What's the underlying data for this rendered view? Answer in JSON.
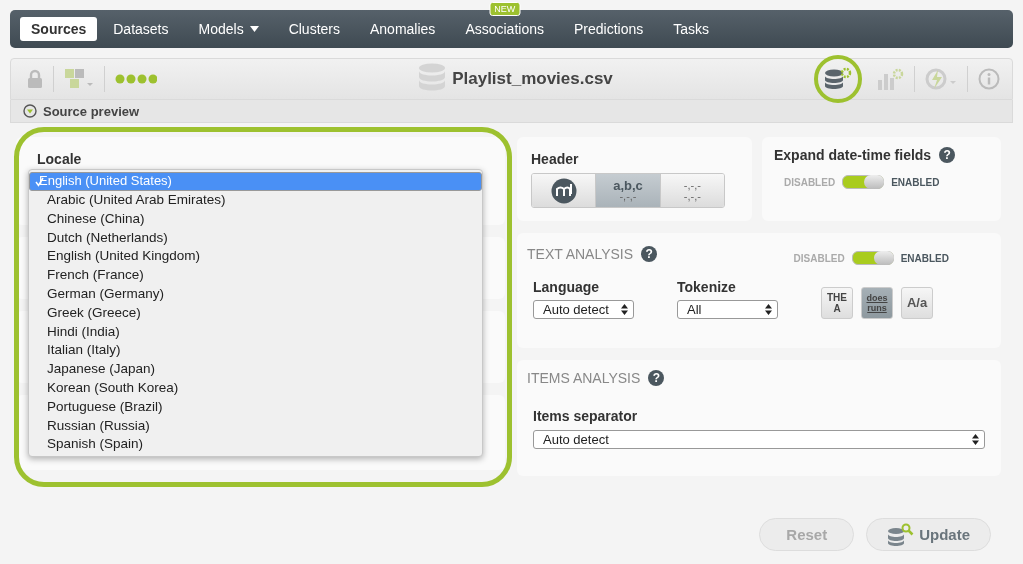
{
  "nav": {
    "items": [
      {
        "label": "Sources",
        "selected": true
      },
      {
        "label": "Datasets",
        "selected": false
      },
      {
        "label": "Models",
        "selected": false,
        "caret": true
      },
      {
        "label": "Clusters",
        "selected": false
      },
      {
        "label": "Anomalies",
        "selected": false
      },
      {
        "label": "Associations",
        "selected": false,
        "badge": "NEW"
      },
      {
        "label": "Predictions",
        "selected": false
      },
      {
        "label": "Tasks",
        "selected": false
      }
    ]
  },
  "toolbar": {
    "title": "Playlist_movies.csv"
  },
  "section": {
    "title": "Source preview",
    "expanded": true
  },
  "locale": {
    "label": "Locale",
    "options": [
      {
        "label": "English (United States)",
        "selected": true
      },
      {
        "label": "Arabic (United Arab Emirates)",
        "selected": false
      },
      {
        "label": "Chinese (China)",
        "selected": false
      },
      {
        "label": "Dutch (Netherlands)",
        "selected": false
      },
      {
        "label": "English (United Kingdom)",
        "selected": false
      },
      {
        "label": "French (France)",
        "selected": false
      },
      {
        "label": "German (Germany)",
        "selected": false
      },
      {
        "label": "Greek (Greece)",
        "selected": false
      },
      {
        "label": "Hindi (India)",
        "selected": false
      },
      {
        "label": "Italian (Italy)",
        "selected": false
      },
      {
        "label": "Japanese (Japan)",
        "selected": false
      },
      {
        "label": "Korean (South Korea)",
        "selected": false
      },
      {
        "label": "Portuguese (Brazil)",
        "selected": false
      },
      {
        "label": "Russian (Russia)",
        "selected": false
      },
      {
        "label": "Spanish (Spain)",
        "selected": false
      }
    ]
  },
  "header": {
    "label": "Header",
    "options": [
      {
        "kind": "logo",
        "selected": false
      },
      {
        "kind": "sample",
        "text": "a,b,c",
        "sub": "-,-,-",
        "selected": true
      },
      {
        "kind": "blank",
        "text": "-,-,-",
        "sub": "-,-,-",
        "selected": false
      }
    ]
  },
  "expand": {
    "label": "Expand date-time fields",
    "help": "?",
    "off_label": "DISABLED",
    "on_label": "ENABLED",
    "on": true
  },
  "text_analysis": {
    "title": "TEXT ANALYSIS",
    "help": "?",
    "off_label": "DISABLED",
    "on_label": "ENABLED",
    "on": true,
    "language": {
      "label": "Language",
      "value": "Auto detect"
    },
    "tokenize": {
      "label": "Tokenize",
      "value": "All"
    },
    "options": [
      {
        "kind": "stopwords",
        "lines": [
          "THE",
          "A"
        ],
        "selected": false
      },
      {
        "kind": "stem",
        "lines": [
          "does",
          "runs"
        ],
        "selected": true
      },
      {
        "kind": "case",
        "lines": [
          "A/a"
        ],
        "selected": false
      }
    ]
  },
  "items_analysis": {
    "title": "ITEMS ANALYSIS",
    "help": "?",
    "separator": {
      "label": "Items separator",
      "value": "Auto detect"
    }
  },
  "buttons": [
    {
      "kind": "reset",
      "label": "Reset",
      "disabled": true
    },
    {
      "kind": "update",
      "label": "Update",
      "disabled": false
    }
  ]
}
